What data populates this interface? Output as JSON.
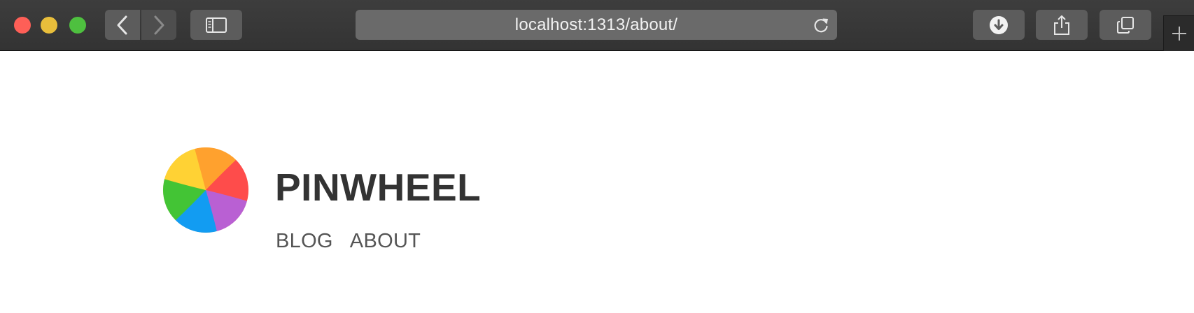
{
  "browser": {
    "url": "localhost:1313/about/",
    "icons": {
      "back": "chevron-left-icon",
      "forward": "chevron-right-icon",
      "sidebar": "sidebar-icon",
      "reload": "reload-icon",
      "download": "download-icon",
      "share": "share-icon",
      "tabs": "tabs-overview-icon",
      "new_tab": "plus-icon"
    },
    "traffic_colors": {
      "close": "#fe5f57",
      "minimize": "#e8be3b",
      "zoom": "#4ec03f"
    }
  },
  "site": {
    "title": "PINWHEEL",
    "logo": "pinwheel-logo",
    "logo_colors": [
      "#ffa12e",
      "#fe4c4b",
      "#b960d3",
      "#129cf2",
      "#43c435",
      "#ffd234"
    ],
    "nav": [
      {
        "label": "BLOG"
      },
      {
        "label": "ABOUT"
      }
    ]
  }
}
